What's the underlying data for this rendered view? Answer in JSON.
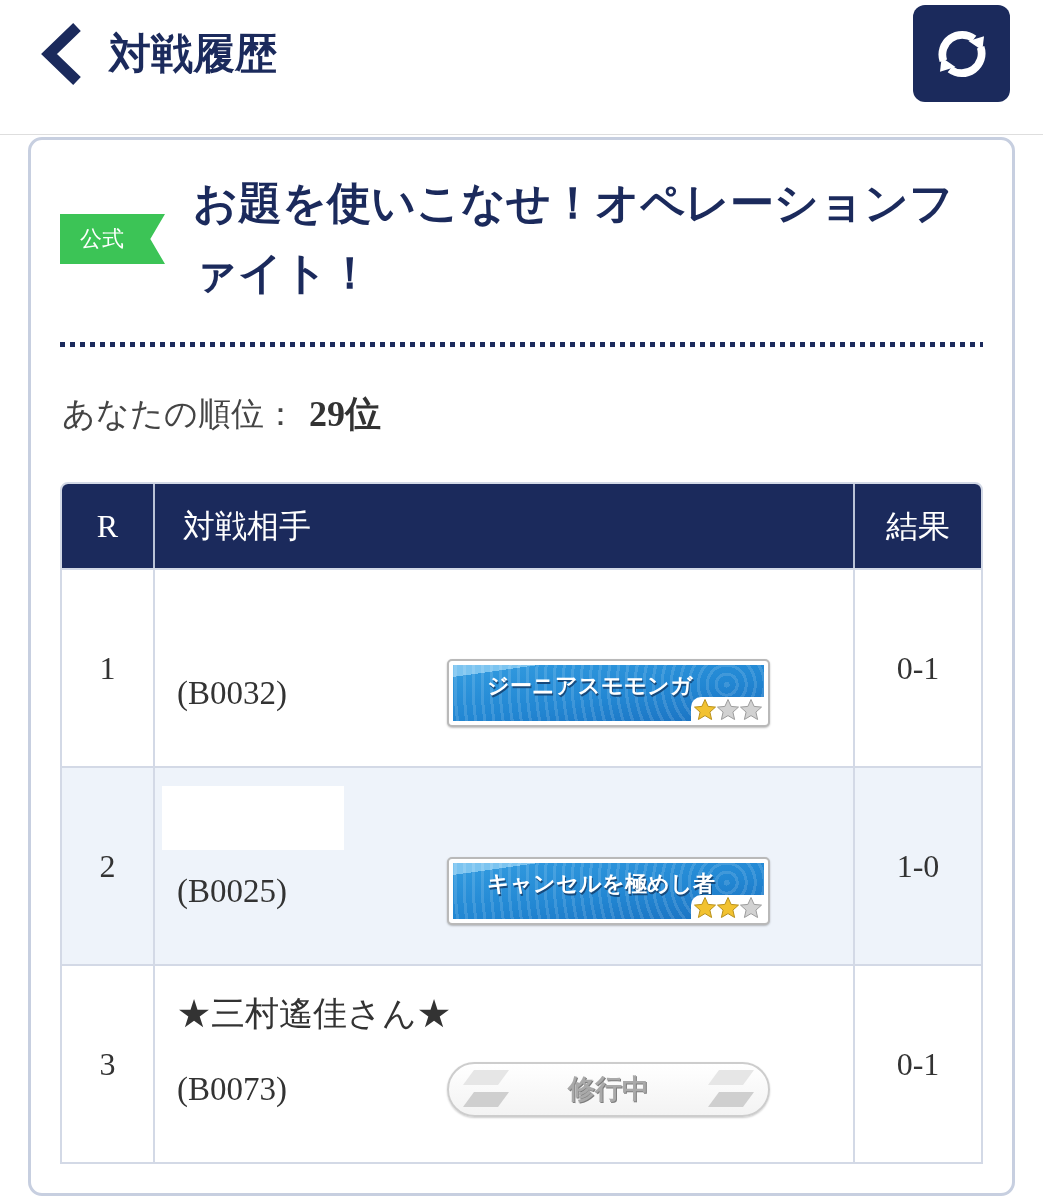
{
  "header": {
    "title": "対戦履歴"
  },
  "event": {
    "tag": "公式",
    "title": "お題を使いこなせ！オペレーションファイト！"
  },
  "rank": {
    "label": "あなたの順位：",
    "value": "29位"
  },
  "table": {
    "columns": [
      "R",
      "対戦相手",
      "結果"
    ],
    "rows": [
      {
        "round": "1",
        "opponent": {
          "id": "(B0032)",
          "badge": {
            "kind": "title",
            "label": "ジーニアスモモンガ",
            "stars": 1
          }
        },
        "result": "0-1"
      },
      {
        "round": "2",
        "opponent": {
          "name_redacted": true,
          "id": "(B0025)",
          "badge": {
            "kind": "title",
            "label": "キャンセルを極めし者",
            "stars": 2
          }
        },
        "result": "1-0"
      },
      {
        "round": "3",
        "opponent": {
          "name": "★三村遙佳さん★",
          "id": "(B0073)",
          "badge": {
            "kind": "training",
            "label": "修行中"
          }
        },
        "result": "0-1"
      }
    ]
  }
}
